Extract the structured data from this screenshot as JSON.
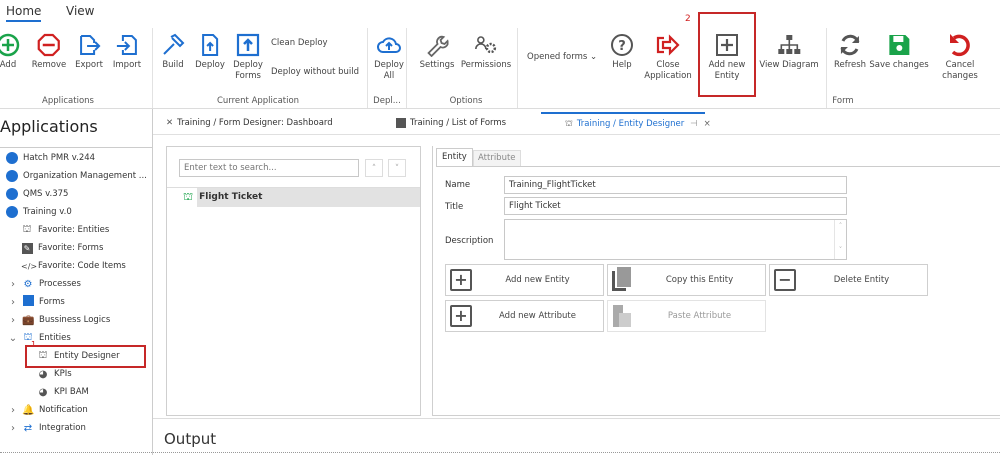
{
  "ribbon": {
    "tabs": [
      "Home",
      "View"
    ],
    "buttons": {
      "add": "Add",
      "remove": "Remove",
      "export": "Export",
      "import": "Import",
      "build": "Build",
      "deploy": "Deploy",
      "deploy_forms": "Deploy Forms",
      "clean_deploy": "Clean Deploy",
      "deploy_without_build": "Deploy without build",
      "deploy_all": "Deploy All",
      "settings": "Settings",
      "permissions": "Permissions",
      "opened_forms": "Opened forms",
      "help": "Help",
      "close_application": "Close Application",
      "add_new_entity": "Add new Entity",
      "view_diagram": "View Diagram",
      "refresh": "Refresh",
      "save_changes": "Save changes",
      "cancel_changes": "Cancel changes"
    },
    "groups": [
      "Applications",
      "Current Application",
      "Depl...",
      "Options",
      "Form"
    ],
    "annotation_step2": "2"
  },
  "sidebar": {
    "title": "Applications",
    "items": [
      {
        "label": "Hatch PMR v.244"
      },
      {
        "label": "Organization Management ..."
      },
      {
        "label": "QMS v.375"
      },
      {
        "label": "Training v.0"
      },
      {
        "label": "Favorite: Entities"
      },
      {
        "label": "Favorite: Forms"
      },
      {
        "label": "Favorite: Code Items"
      },
      {
        "label": "Processes"
      },
      {
        "label": "Forms"
      },
      {
        "label": "Bussiness Logics"
      },
      {
        "label": "Entities"
      },
      {
        "label": "Entity Designer"
      },
      {
        "label": "KPIs"
      },
      {
        "label": "KPI BAM"
      },
      {
        "label": "Notification"
      },
      {
        "label": "Integration"
      }
    ],
    "annotation_step1": "1"
  },
  "doc_tabs": [
    {
      "label": "Training / Form Designer: Dashboard"
    },
    {
      "label": "Training / List of Forms"
    },
    {
      "label": "Training / Entity Designer"
    }
  ],
  "entity_list": {
    "search_placeholder": "Enter text to search...",
    "items": [
      "Flight Ticket"
    ]
  },
  "editor": {
    "tabs": [
      "Entity",
      "Attribute"
    ],
    "name_label": "Name",
    "name_value": "Training_FlightTicket",
    "title_label": "Title",
    "title_value": "Flight Ticket",
    "description_label": "Description",
    "description_value": "",
    "buttons": {
      "add_entity": "Add new Entity",
      "copy_entity": "Copy this Entity",
      "delete_entity": "Delete Entity",
      "add_attribute": "Add new Attribute",
      "paste_attribute": "Paste Attribute"
    }
  },
  "output": {
    "title": "Output"
  },
  "colors": {
    "accent": "#1e6fd0",
    "highlight": "#d02020",
    "green": "#1aa34a"
  }
}
